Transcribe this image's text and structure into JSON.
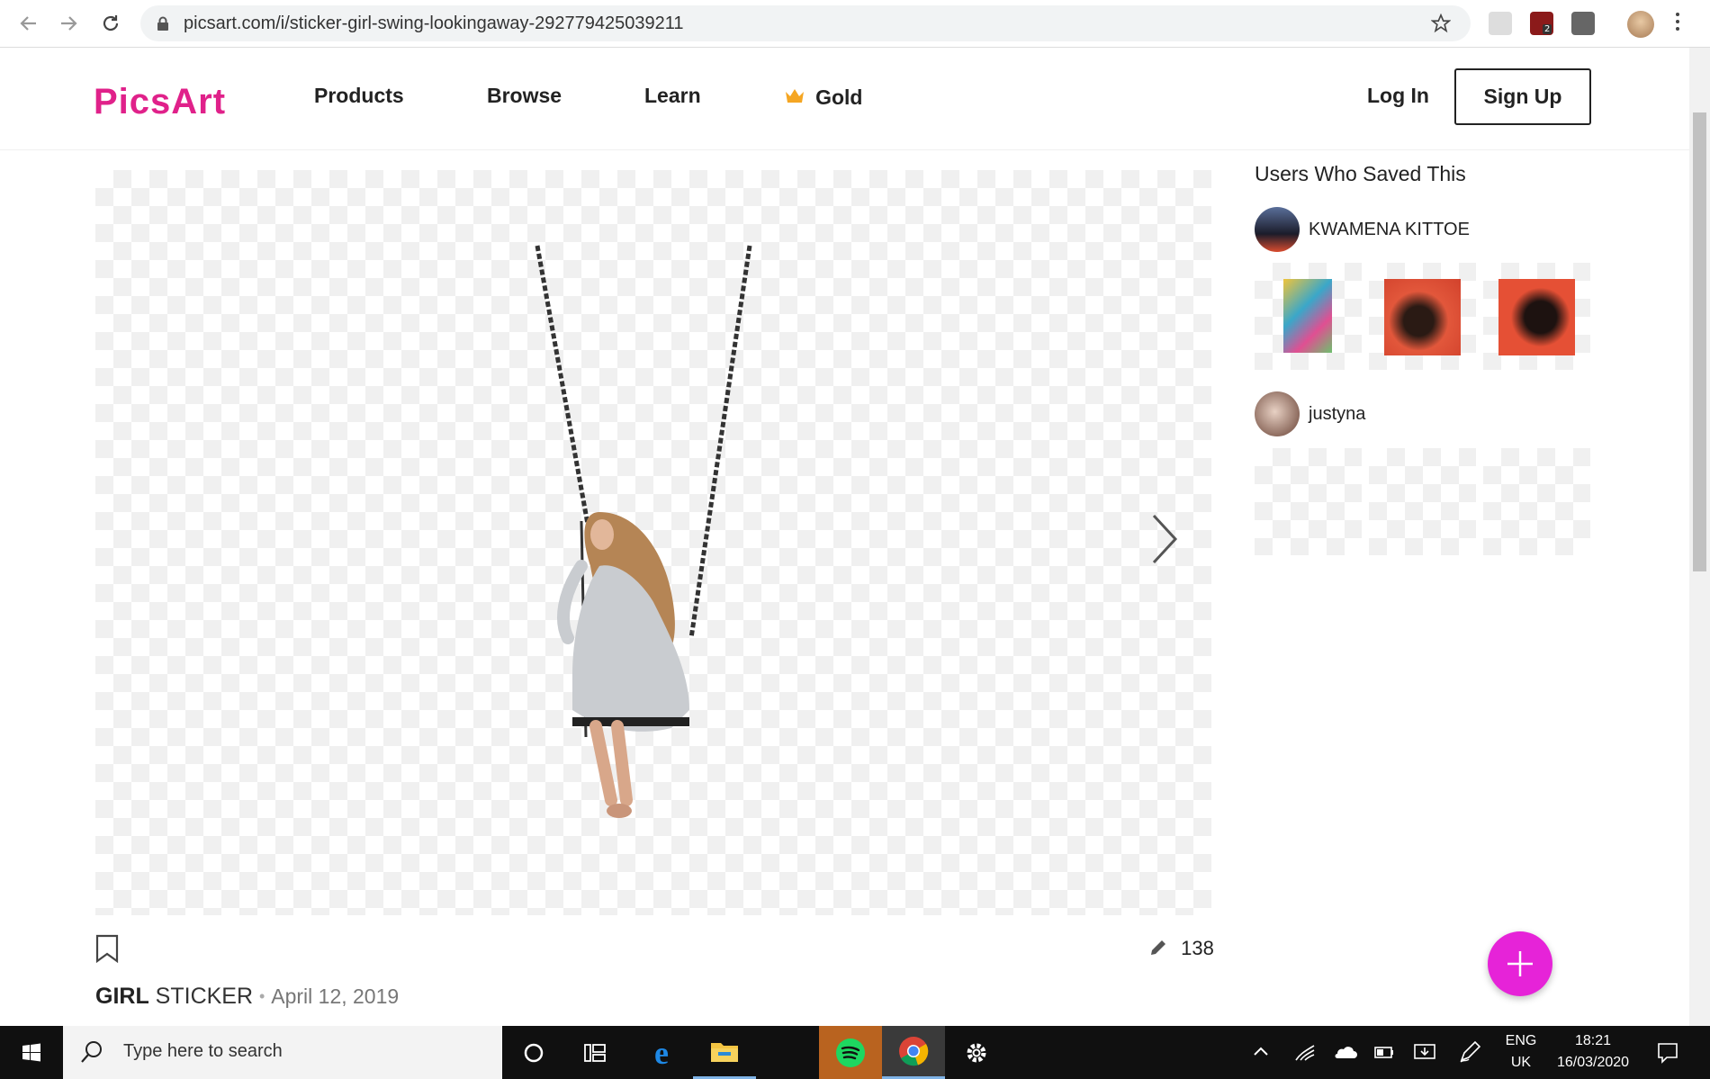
{
  "browser": {
    "url": "picsart.com/i/sticker-girl-swing-lookingaway-292779425039211",
    "badge_count": "2"
  },
  "header": {
    "logo": "PicsArt",
    "nav": [
      "Products",
      "Browse",
      "Learn"
    ],
    "gold_label": "Gold",
    "login_label": "Log In",
    "signup_label": "Sign Up"
  },
  "sticker": {
    "title_main": "GIRL",
    "title_type": "STICKER",
    "separator": "•",
    "date": "April 12, 2019",
    "edits_count": "138"
  },
  "sidebar": {
    "title": "Users Who Saved This",
    "users": [
      {
        "name": "KWAMENA KITTOE"
      },
      {
        "name": "justyna"
      }
    ]
  },
  "taskbar": {
    "search_placeholder": "Type here to search",
    "lang_top": "ENG",
    "lang_bottom": "UK",
    "time": "18:21",
    "date": "16/03/2020"
  },
  "colors": {
    "brand": "#e0218a",
    "fab": "#e623d8",
    "gold": "#f5a623"
  }
}
